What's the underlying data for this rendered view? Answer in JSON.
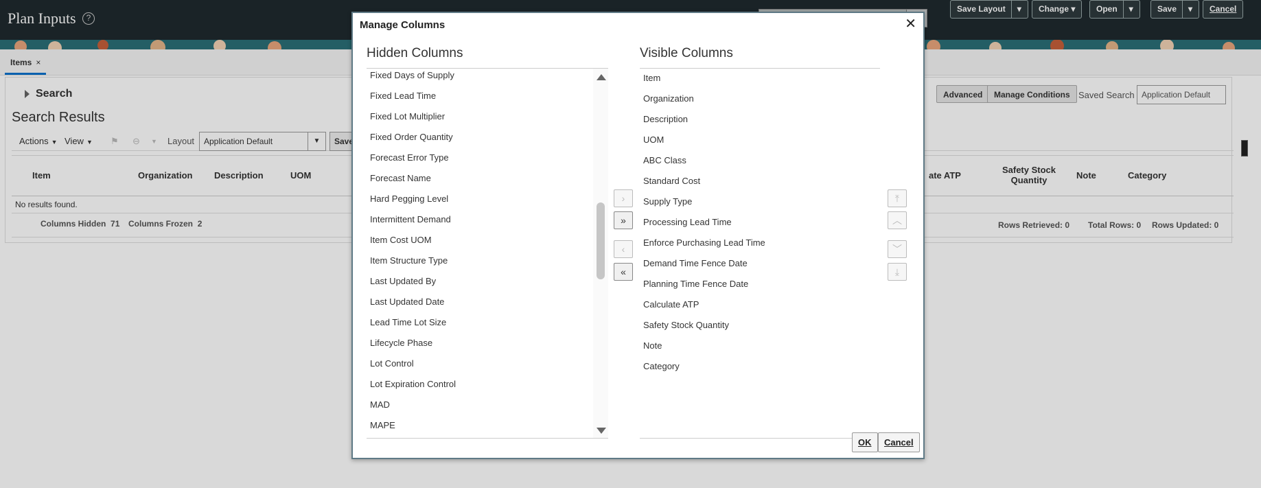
{
  "header": {
    "title": "Plan Inputs",
    "help_icon": "?",
    "buttons": {
      "save_layout": "Save Layout",
      "change": "Change",
      "open": "Open",
      "save": "Save",
      "cancel": "Cancel"
    }
  },
  "tabs": [
    {
      "label": "Items",
      "close": "×"
    }
  ],
  "search": {
    "header": "Search",
    "advanced": "Advanced",
    "manage_conditions": "Manage Conditions",
    "saved_search_label": "Saved Search",
    "saved_search_value": "Application Default"
  },
  "results": {
    "title": "Search Results",
    "actions": "Actions",
    "view": "View",
    "layout_label": "Layout",
    "layout_value": "Application Default",
    "save_trunc": "Save",
    "columns": [
      "Item",
      "Organization",
      "Description",
      "UOM",
      "ate ATP",
      "Safety Stock Quantity",
      "Note",
      "Category"
    ],
    "no_results": "No results found.",
    "columns_hidden_label": "Columns Hidden",
    "columns_hidden_value": "71",
    "columns_frozen_label": "Columns Frozen",
    "columns_frozen_value": "2",
    "rows_retrieved": "Rows Retrieved: 0",
    "total_rows": "Total Rows: 0",
    "rows_updated": "Rows Updated: 0"
  },
  "dialog": {
    "title": "Manage Columns",
    "close": "✕",
    "hidden_title": "Hidden Columns",
    "visible_title": "Visible Columns",
    "hidden_columns": [
      "Fixed Days of Supply",
      "Fixed Lead Time",
      "Fixed Lot Multiplier",
      "Fixed Order Quantity",
      "Forecast Error Type",
      "Forecast Name",
      "Hard Pegging Level",
      "Intermittent Demand",
      "Item Cost UOM",
      "Item Structure Type",
      "Last Updated By",
      "Last Updated Date",
      "Lead Time Lot Size",
      "Lifecycle Phase",
      "Lot Control",
      "Lot Expiration Control",
      "MAD",
      "MAPE"
    ],
    "visible_columns": [
      "Item",
      "Organization",
      "Description",
      "UOM",
      "ABC Class",
      "Standard Cost",
      "Supply Type",
      "Processing Lead Time",
      "Enforce Purchasing Lead Time",
      "Demand Time Fence Date",
      "Planning Time Fence Date",
      "Calculate ATP",
      "Safety Stock Quantity",
      "Note",
      "Category"
    ],
    "move_buttons": {
      "move_selected_right": "›",
      "move_all_right": "»",
      "move_selected_left": "‹",
      "move_all_left": "«"
    },
    "order_buttons": {
      "move_top": "⤒",
      "move_up": "︿",
      "move_down": "﹀",
      "move_bottom": "⤓"
    },
    "ok": "OK",
    "cancel": "Cancel"
  },
  "colors": {
    "header_bg": "#1f2a2e",
    "dialog_border": "#5f7a86",
    "tab_accent": "#0572ce"
  }
}
